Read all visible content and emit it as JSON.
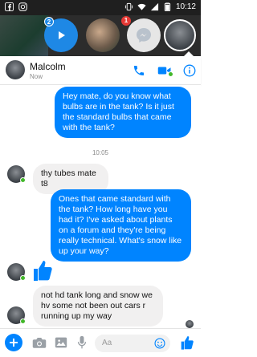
{
  "status_bar": {
    "time": "10:12",
    "icons": [
      "facebook-icon",
      "instagram-icon",
      "vibrate-icon",
      "wifi-icon",
      "signal-icon",
      "battery-icon"
    ]
  },
  "chat_heads": {
    "play_badge": "2",
    "messenger_badge": "1"
  },
  "header": {
    "name": "Malcolm",
    "status": "Now"
  },
  "messages": [
    {
      "from": "me",
      "text": "Hey mate, do you know what bulbs are in the tank? Is it just the standard bulbs that came with the tank?"
    },
    {
      "timestamp": "10:05"
    },
    {
      "from": "malcolm",
      "text": "thy tubes mate t8"
    },
    {
      "from": "me",
      "text": "Ones that came standard with the tank? How long have you had it? I've asked about plants on a forum and they're being really technical. What's snow like up your way?"
    },
    {
      "from": "malcolm",
      "type": "like"
    },
    {
      "from": "malcolm",
      "text": "not hd tank long  and snow  we hv some not been out cars r running up my way"
    }
  ],
  "composer": {
    "placeholder": "Aa"
  },
  "colors": {
    "brand_blue": "#0084ff",
    "incoming_bubble": "#f1f0f0",
    "online_green": "#42b72a",
    "badge_red": "#e53935"
  }
}
